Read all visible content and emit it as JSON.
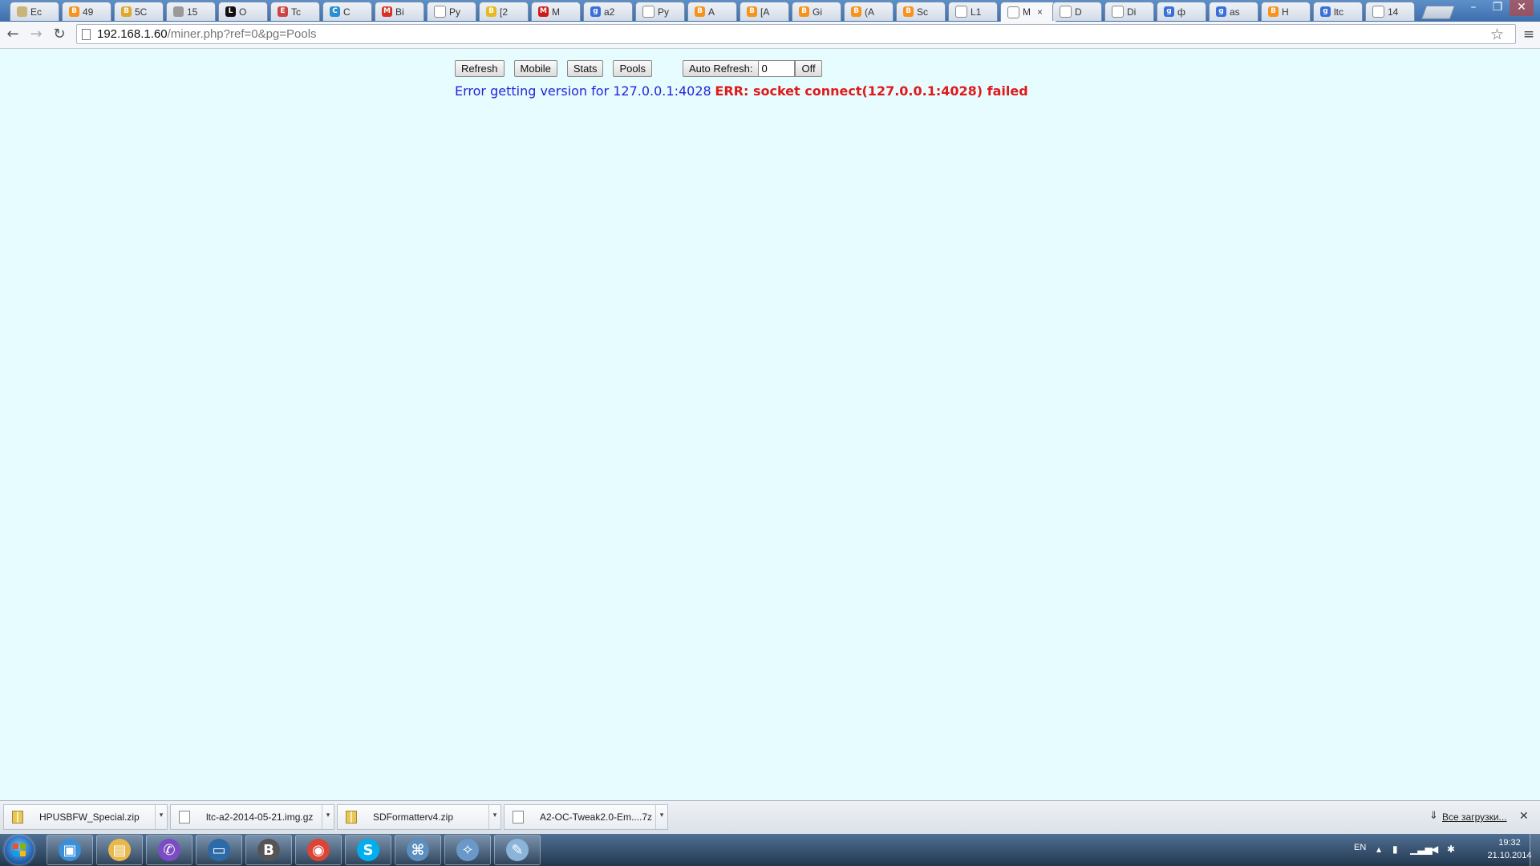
{
  "tabs": [
    {
      "label": "Ec",
      "icon": "tab-favicon-doc-icon",
      "color": "#c9b47a",
      "glyph": ""
    },
    {
      "label": "49",
      "icon": "tab-favicon-bitcoin-icon",
      "color": "#f7931a",
      "glyph": "B"
    },
    {
      "label": "5C",
      "icon": "tab-favicon-coin-icon",
      "color": "#e0a72a",
      "glyph": "B"
    },
    {
      "label": "15",
      "icon": "tab-favicon-paw-icon",
      "color": "#9a9a9a",
      "glyph": ""
    },
    {
      "label": "O",
      "icon": "tab-favicon-ltc-icon",
      "color": "#111111",
      "glyph": "L"
    },
    {
      "label": "Tc",
      "icon": "tab-favicon-em-icon",
      "color": "#c44",
      "glyph": "E"
    },
    {
      "label": "C",
      "icon": "tab-favicon-globe-icon",
      "color": "#2a8fd0",
      "glyph": "C"
    },
    {
      "label": "Bi",
      "icon": "tab-favicon-gmail-icon",
      "color": "#d93025",
      "glyph": "M"
    },
    {
      "label": "Py",
      "icon": "tab-favicon-page-icon",
      "color": "#ffffff",
      "glyph": ""
    },
    {
      "label": "[2",
      "icon": "tab-favicon-coin-icon",
      "color": "#e8b820",
      "glyph": "B"
    },
    {
      "label": "M",
      "icon": "tab-favicon-mail-icon",
      "color": "#d01818",
      "glyph": "M"
    },
    {
      "label": "a2",
      "icon": "tab-favicon-google-icon",
      "color": "#3b6fd8",
      "glyph": "g"
    },
    {
      "label": "Py",
      "icon": "tab-favicon-page-icon",
      "color": "#ffffff",
      "glyph": ""
    },
    {
      "label": "A",
      "icon": "tab-favicon-bitcoin-icon",
      "color": "#f7931a",
      "glyph": "B"
    },
    {
      "label": "[A",
      "icon": "tab-favicon-bitcoin-icon",
      "color": "#f7931a",
      "glyph": "B"
    },
    {
      "label": "Gi",
      "icon": "tab-favicon-bitcoin-icon",
      "color": "#f7931a",
      "glyph": "B"
    },
    {
      "label": "(A",
      "icon": "tab-favicon-bitcoin-icon",
      "color": "#f7931a",
      "glyph": "B"
    },
    {
      "label": "Sc",
      "icon": "tab-favicon-bitcoin-icon",
      "color": "#f7931a",
      "glyph": "B"
    },
    {
      "label": "L1",
      "icon": "tab-favicon-page-icon",
      "color": "#ffffff",
      "glyph": ""
    },
    {
      "label": "M",
      "icon": "tab-favicon-page-icon",
      "color": "#ffffff",
      "glyph": "",
      "active": true
    },
    {
      "label": "D",
      "icon": "tab-favicon-page-icon",
      "color": "#ffffff",
      "glyph": ""
    },
    {
      "label": "Di",
      "icon": "tab-favicon-page-icon",
      "color": "#ffffff",
      "glyph": ""
    },
    {
      "label": "ф",
      "icon": "tab-favicon-google-icon",
      "color": "#3b6fd8",
      "glyph": "g"
    },
    {
      "label": "as",
      "icon": "tab-favicon-google-icon",
      "color": "#3b6fd8",
      "glyph": "g"
    },
    {
      "label": "H",
      "icon": "tab-favicon-bitcoin-icon",
      "color": "#f7931a",
      "glyph": "B"
    },
    {
      "label": "ltc",
      "icon": "tab-favicon-google-icon",
      "color": "#3b6fd8",
      "glyph": "g"
    },
    {
      "label": "14",
      "icon": "tab-favicon-page-icon",
      "color": "#ffffff",
      "glyph": ""
    }
  ],
  "window": {
    "minimize": "–",
    "restore": "❐",
    "close": "✕"
  },
  "toolbar": {
    "back": "←",
    "forward": "→",
    "reload": "↻",
    "url_host": "192.168.1.60",
    "url_path": "/miner.php?ref=0&pg=Pools",
    "star": "☆",
    "menu": "≡"
  },
  "page": {
    "buttons": {
      "refresh": "Refresh",
      "mobile": "Mobile",
      "stats": "Stats",
      "pools": "Pools"
    },
    "auto_refresh": {
      "label": "Auto Refresh:",
      "value": "0",
      "off": "Off"
    },
    "error": {
      "message": "Error getting version for 127.0.0.1:4028",
      "detail": "ERR: socket connect(127.0.0.1:4028) failed"
    }
  },
  "downloads": {
    "items": [
      {
        "name": "HPUSBFW_Special.zip",
        "type": "zip"
      },
      {
        "name": "ltc-a2-2014-05-21.img.gz",
        "type": "file"
      },
      {
        "name": "SDFormatterv4.zip",
        "type": "zip"
      },
      {
        "name": "A2-OC-Tweak2.0-Em....7z",
        "type": "file"
      }
    ],
    "all_label": "Все загрузки...",
    "close": "✕"
  },
  "taskbar": {
    "apps": [
      {
        "name": "taskbar-photo-viewer",
        "color": "#3a8fd8",
        "glyph": "▣"
      },
      {
        "name": "taskbar-explorer",
        "color": "#e8b84a",
        "glyph": "▤"
      },
      {
        "name": "taskbar-viber",
        "color": "#7b4cc4",
        "glyph": "✆"
      },
      {
        "name": "taskbar-computer",
        "color": "#2c6aa8",
        "glyph": "▭"
      },
      {
        "name": "taskbar-bitcoin",
        "color": "#555555",
        "glyph": "B"
      },
      {
        "name": "taskbar-chrome",
        "color": "#db4437",
        "glyph": "◉"
      },
      {
        "name": "taskbar-skype",
        "color": "#00aff0",
        "glyph": "S"
      },
      {
        "name": "taskbar-network-tool",
        "color": "#5b8fc0",
        "glyph": "⌘"
      },
      {
        "name": "taskbar-connection-tool",
        "color": "#6a98c8",
        "glyph": "✧"
      },
      {
        "name": "taskbar-paint",
        "color": "#8ab4d8",
        "glyph": "✎"
      }
    ],
    "lang": "EN",
    "time": "19:32",
    "date": "21.10.2014"
  }
}
